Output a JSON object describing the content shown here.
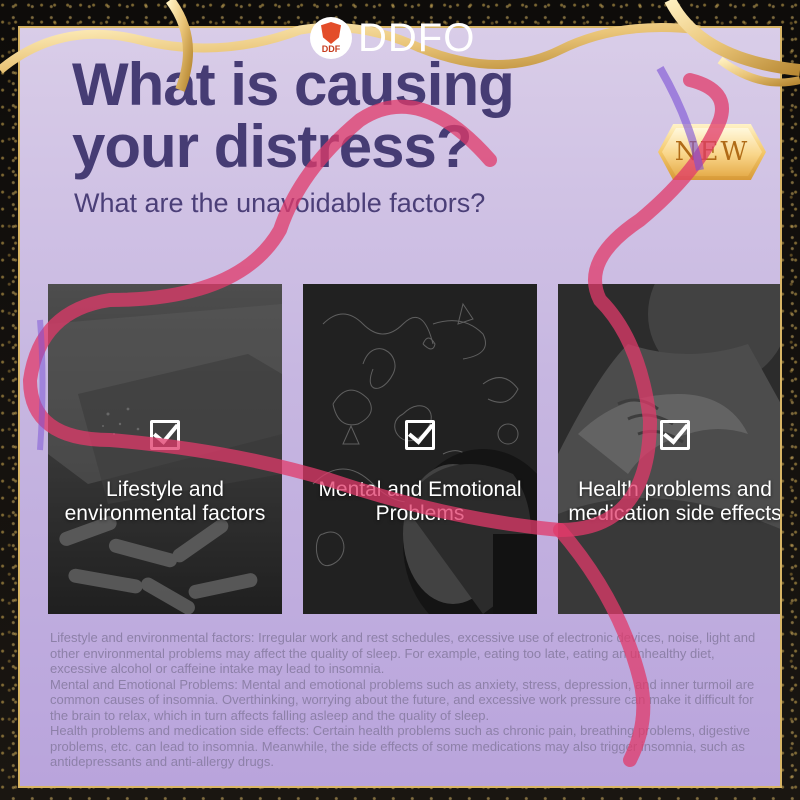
{
  "brand": {
    "logo_text": "DDF",
    "name": "DDFO"
  },
  "headline": {
    "line1": "What is causing",
    "line2": "your distress?"
  },
  "subheading": "What are the unavoidable factors?",
  "badge": "NEW",
  "cards": [
    {
      "title": "Lifestyle and environmental factors"
    },
    {
      "title": "Mental and Emotional Problems"
    },
    {
      "title": "Health problems and medication side effects"
    }
  ],
  "paragraphs": [
    "Lifestyle and environmental factors: Irregular work and rest schedules, excessive use of electronic devices, noise, light and other environmental problems may affect the quality of sleep. For example, eating too late, eating an unhealthy diet, excessive alcohol or caffeine intake may lead to insomnia.",
    "Mental and Emotional Problems: Mental and emotional problems such as anxiety, stress, depression, and inner turmoil are common causes of insomnia. Overthinking, worrying about the future, and excessive work pressure can make it difficult for the brain to relax, which in turn affects falling asleep and the quality of sleep.",
    "Health problems and medication side effects: Certain health problems such as chronic pain, breathing problems, digestive problems, etc. can lead to insomnia. Meanwhile, the side effects of some medications may also trigger insomnia, such as antidepressants and anti-allergy drugs."
  ],
  "colors": {
    "headline": "#463c74",
    "panel_top": "#d9cde8",
    "panel_bottom": "#b9a4dc",
    "ribbon": "#e03a6a",
    "gold": "#d8b565"
  },
  "icons": [
    "checkbox-check-icon",
    "ddf-shield-logo"
  ]
}
